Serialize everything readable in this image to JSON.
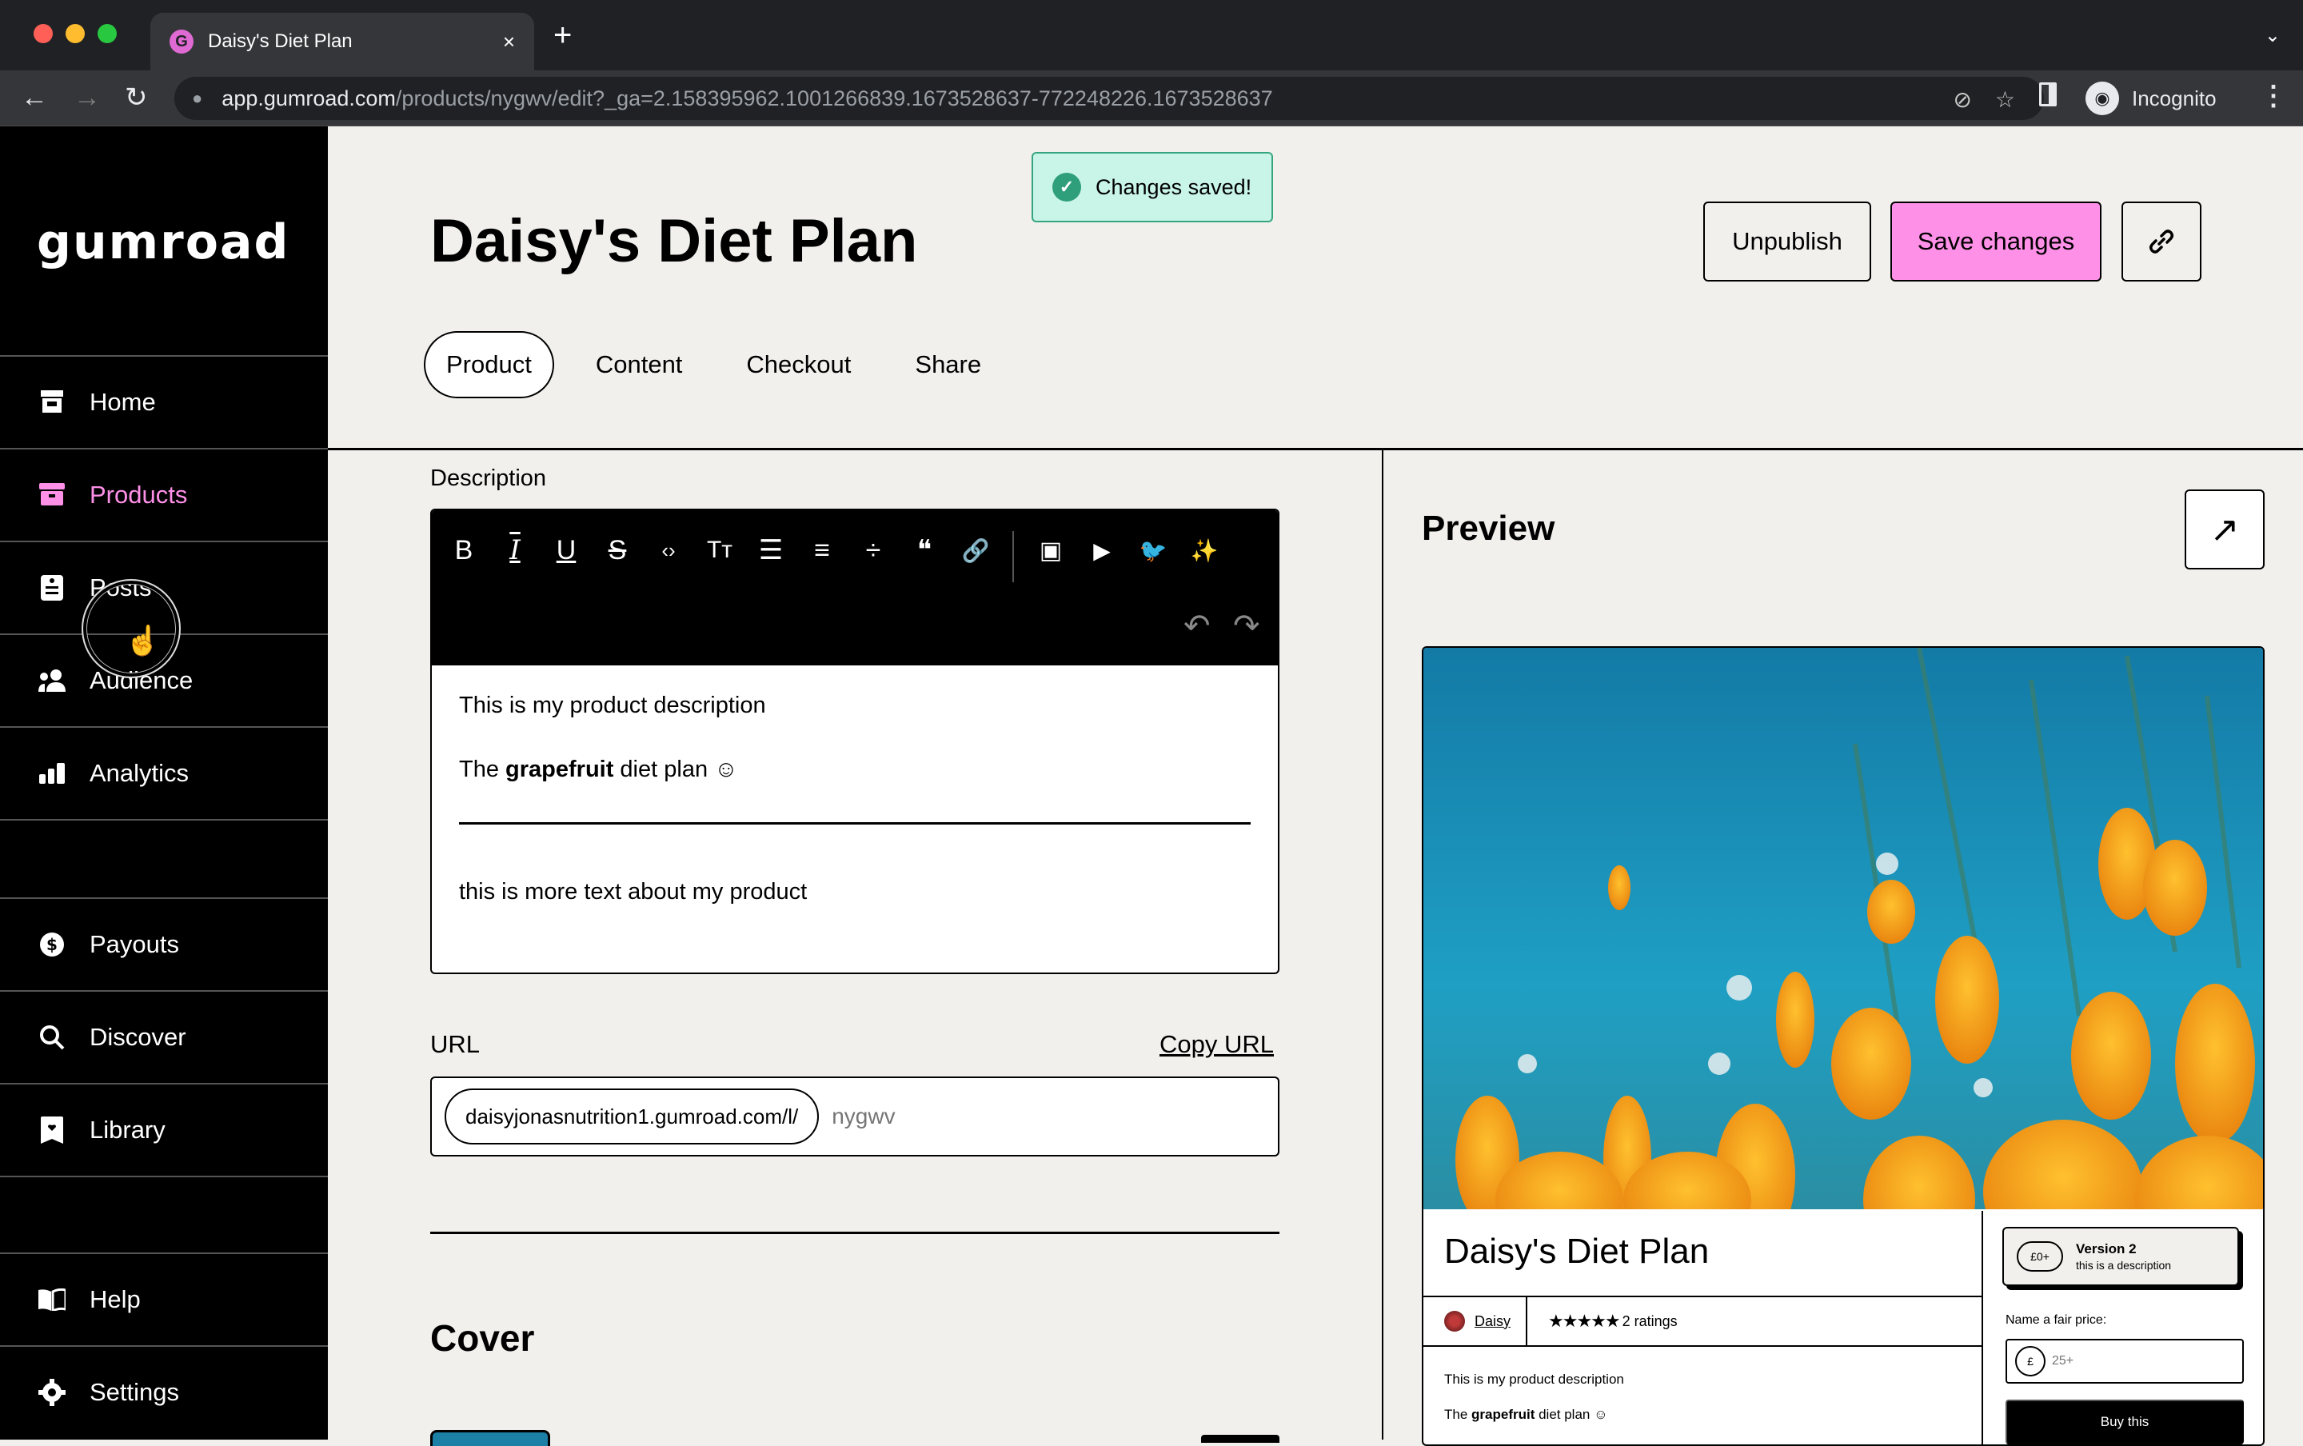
{
  "browser": {
    "tab_title": "Daisy's Diet Plan",
    "tab_favicon": "G",
    "url_host": "app.gumroad.com",
    "url_path": "/products/nygwv/edit?_ga=2.158395962.1001266839.1673528637-772248226.1673528637",
    "profile_label": "Incognito",
    "icons": {
      "back": "←",
      "forward": "→",
      "reload": "↻",
      "lock": "🔒",
      "eye_off": "⊘",
      "star": "☆",
      "menu": "⋮",
      "close": "×",
      "new_tab": "+",
      "dropdown": "⌄",
      "incognito": "🕶"
    }
  },
  "sidebar": {
    "logo": "Gumroad",
    "items": [
      {
        "label": "Home",
        "icon": "⌂"
      },
      {
        "label": "Products",
        "icon": "▤",
        "active": true
      },
      {
        "label": "Posts",
        "icon": "▦"
      },
      {
        "label": "Audience",
        "icon": "👥"
      },
      {
        "label": "Analytics",
        "icon": "▮"
      }
    ],
    "lower_items": [
      {
        "label": "Payouts",
        "icon": "$"
      },
      {
        "label": "Discover",
        "icon": "⌕"
      },
      {
        "label": "Library",
        "icon": "♥"
      }
    ],
    "bottom_items": [
      {
        "label": "Help",
        "icon": "📖"
      },
      {
        "label": "Settings",
        "icon": "⚙"
      }
    ]
  },
  "toast": {
    "text": "Changes saved!",
    "icon": "✓"
  },
  "header": {
    "title": "Daisy's Diet Plan",
    "buttons": {
      "unpublish": "Unpublish",
      "save": "Save changes",
      "link_icon": "🔗"
    },
    "tabs": [
      {
        "label": "Product",
        "active": true
      },
      {
        "label": "Content"
      },
      {
        "label": "Checkout"
      },
      {
        "label": "Share"
      }
    ]
  },
  "description": {
    "label": "Description",
    "toolbar": [
      "B",
      "I",
      "U",
      "S",
      "‹›",
      "Tт",
      "☰",
      "≡",
      "÷",
      "❝",
      "🔗",
      "▣",
      "▶",
      "🐦",
      "✨"
    ],
    "undo": "↶",
    "redo": "↷",
    "paragraph1": "This is my product description",
    "paragraph2_prefix": "The ",
    "paragraph2_bold": "grapefruit",
    "paragraph2_suffix": " diet plan ☺",
    "paragraph3": "this is more text about my product"
  },
  "url": {
    "label": "URL",
    "copy_label": "Copy URL",
    "prefix": "daisyjonasnutrition1.gumroad.com/l/",
    "placeholder": "nygwv",
    "value": ""
  },
  "cover": {
    "title": "Cover"
  },
  "preview": {
    "title": "Preview",
    "open_icon": "↗",
    "product_name": "Daisy's Diet Plan",
    "creator": "Daisy",
    "rating_stars": 5,
    "stars_text": "★★★★★",
    "ratings_label": "2 ratings",
    "desc1": "This is my product description",
    "desc2_prefix": "The ",
    "desc2_bold": "grapefruit",
    "desc2_suffix": " diet plan ☺",
    "version": {
      "price": "£0+",
      "name": "Version 2",
      "description": "this is a description"
    },
    "price_label": "Name a fair price:",
    "currency": "£",
    "price_placeholder": "25+",
    "buy_label": "Buy this"
  },
  "colors": {
    "accent_pink": "#ff90e8",
    "toast_bg": "#c9f5e8",
    "toast_green": "#2f9e7a",
    "page_bg": "#f1f0ed"
  }
}
